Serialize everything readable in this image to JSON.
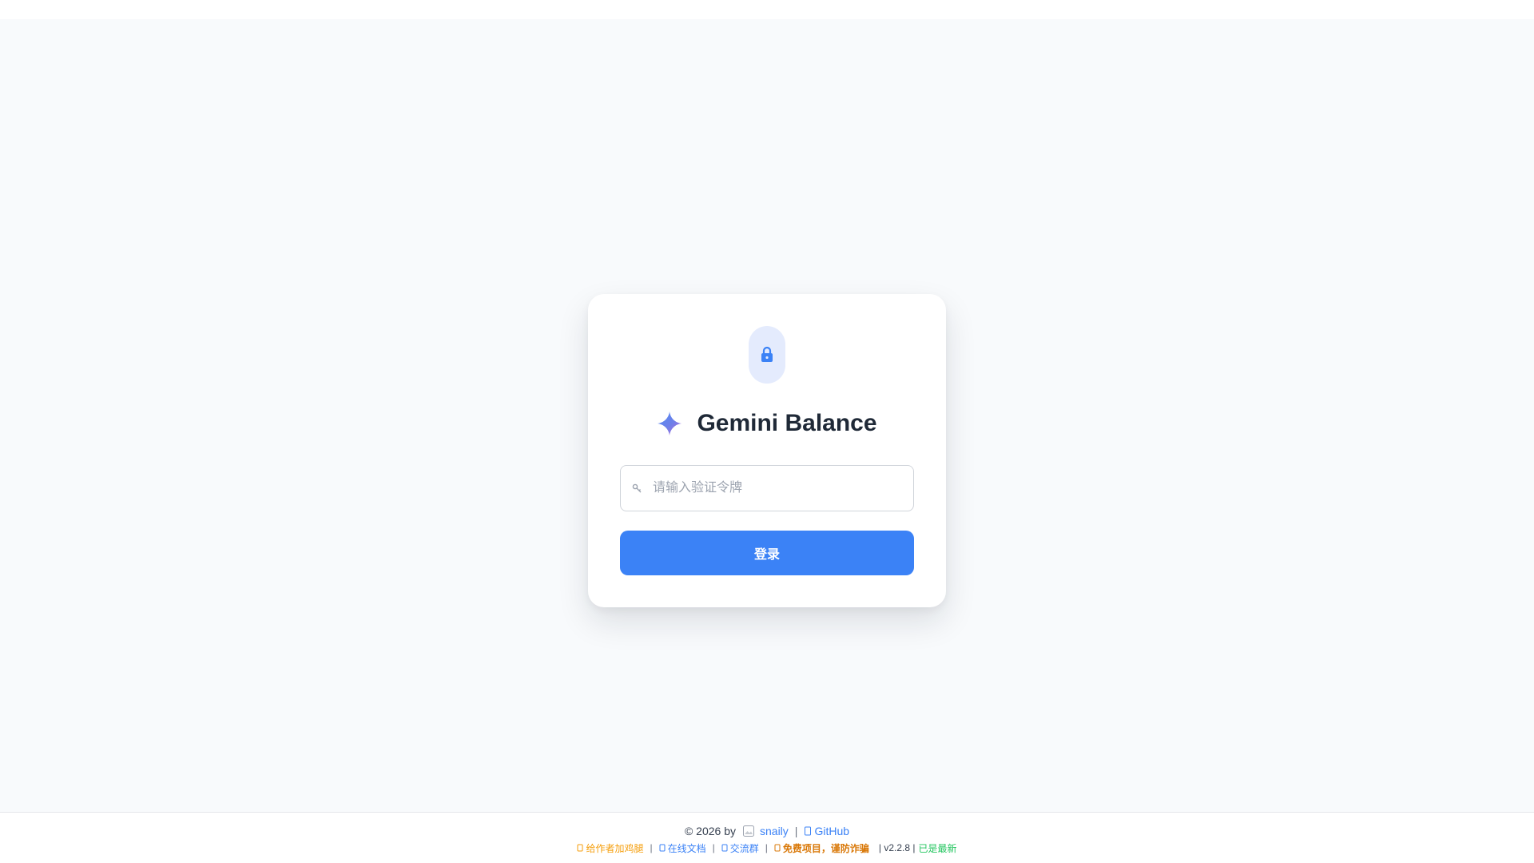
{
  "app": {
    "title": "Gemini Balance",
    "brand_color": "#3b82f6",
    "icons": [
      "lock-icon",
      "gemini-sparkle-icon",
      "key-icon",
      "avatar-image",
      "github-icon",
      "coffee-icon",
      "book-icon",
      "users-icon",
      "warning-icon"
    ]
  },
  "login": {
    "token_placeholder": "请输入验证令牌",
    "token_value": "",
    "submit_label": "登录"
  },
  "footer": {
    "copyright_prefix": "© 2026 by",
    "author": "snaily",
    "github_label": "GitHub",
    "sep": "|",
    "links": {
      "donate": "给作者加鸡腿",
      "docs": "在线文档",
      "group": "交流群",
      "warning": "免费项目，谨防诈骗"
    },
    "version_text": "| v2.2.8 |",
    "update_status": "已是最新",
    "colors": {
      "link": "#3b82f6",
      "donate": "#f59e0b",
      "warning": "#d97706",
      "latest": "#22c55e"
    }
  }
}
